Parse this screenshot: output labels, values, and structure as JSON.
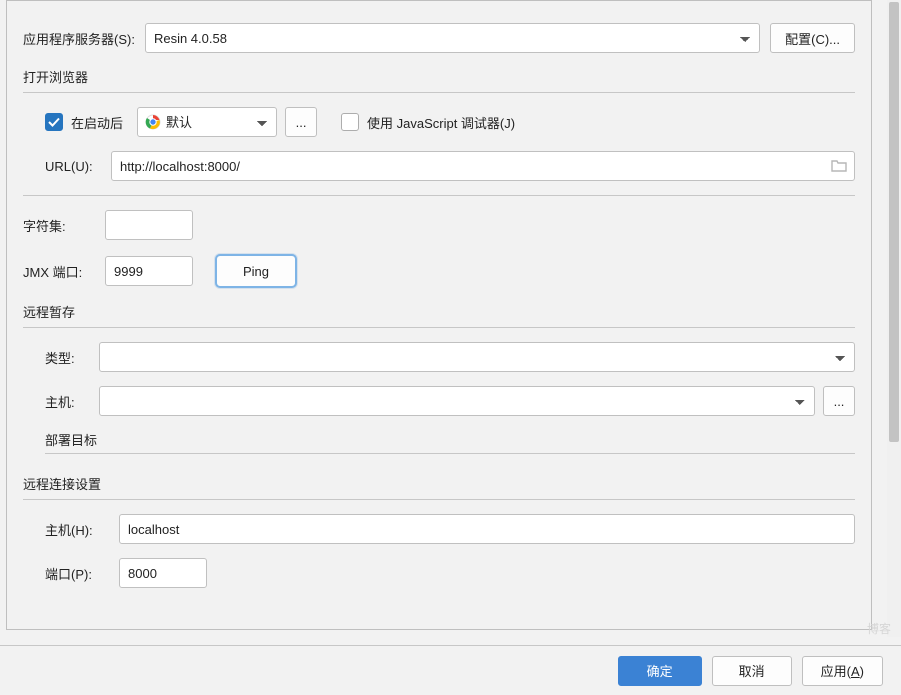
{
  "server": {
    "label": "应用程序服务器(S):",
    "value": "Resin 4.0.58",
    "configure_btn": "配置(C)..."
  },
  "browser": {
    "title": "打开浏览器",
    "after_start_label": "在启动后",
    "after_start_checked": true,
    "browser_value": "默认",
    "js_debugger_label": "使用 JavaScript 调试器(J)",
    "js_debugger_checked": false,
    "ellipsis": "...",
    "url_label": "URL(U):",
    "url_value": "http://localhost:8000/"
  },
  "charset": {
    "label": "字符集:",
    "value": ""
  },
  "jmx": {
    "label": "JMX 端口:",
    "value": "9999",
    "ping_btn": "Ping"
  },
  "remote_staging": {
    "title": "远程暂存",
    "type_label": "类型:",
    "type_value": "",
    "host_label": "主机:",
    "host_value": "",
    "ellipsis": "...",
    "deploy_target_label": "部署目标"
  },
  "remote_conn": {
    "title": "远程连接设置",
    "host_label": "主机(H):",
    "host_value": "localhost",
    "port_label": "端口(P):",
    "port_value": "8000"
  },
  "footer": {
    "ok": "确定",
    "cancel": "取消",
    "apply": "应用(A)"
  },
  "watermark": "博客"
}
